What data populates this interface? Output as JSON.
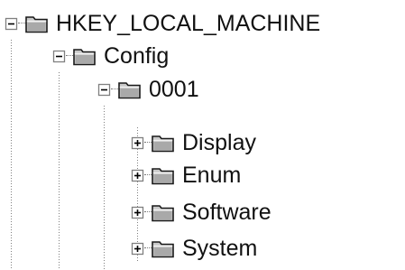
{
  "tree": {
    "root": {
      "label": "HKEY_LOCAL_MACHINE",
      "state": "expanded",
      "icon": "folder-icon"
    },
    "config": {
      "label": "Config",
      "state": "expanded",
      "icon": "folder-icon"
    },
    "profile": {
      "label": "0001",
      "state": "expanded",
      "icon": "folder-icon"
    },
    "children": [
      {
        "label": "Display",
        "state": "collapsed",
        "icon": "folder-icon"
      },
      {
        "label": "Enum",
        "state": "collapsed",
        "icon": "folder-icon"
      },
      {
        "label": "Software",
        "state": "collapsed",
        "icon": "folder-icon"
      },
      {
        "label": "System",
        "state": "collapsed",
        "icon": "folder-icon"
      }
    ]
  }
}
